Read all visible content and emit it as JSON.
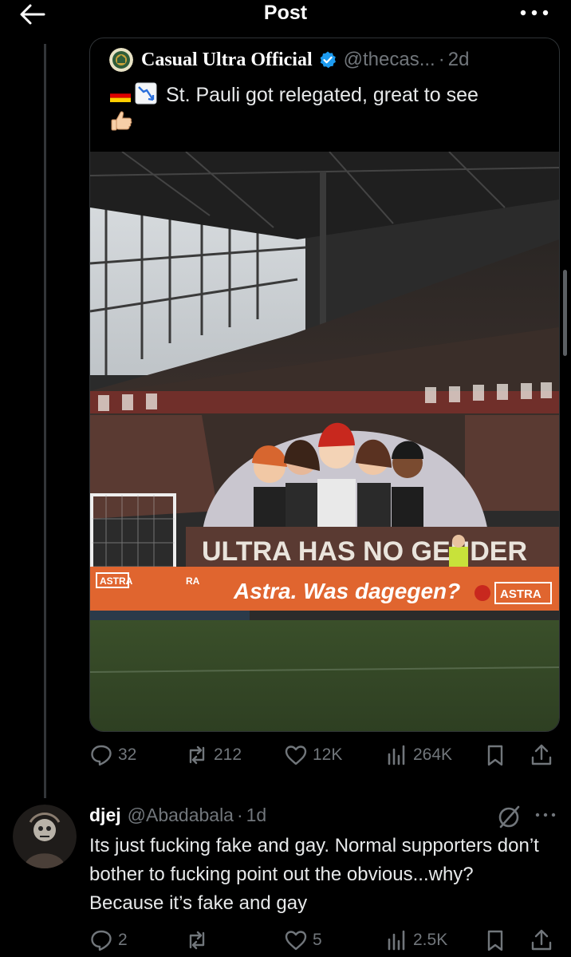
{
  "header": {
    "title": "Post",
    "back_icon": "arrow-left-icon",
    "more_icon": "more-horizontal-icon"
  },
  "quote": {
    "author_name": "Casual Ultra Official",
    "author_handle": "@thecas...",
    "separator": "·",
    "time": "2d",
    "verified": true,
    "text": "St. Pauli got relegated, great to see",
    "emojis": [
      "germany-flag-emoji",
      "chart-decreasing-emoji",
      "thumbs-up-emoji"
    ],
    "media": {
      "banner_text": "ULTRA HAS NO GENDER",
      "ad_text": "Astra. Was dagegen?",
      "sponsor": "ASTRA",
      "left_sponsor": "ASTRA",
      "mid_sponsor": "RA"
    }
  },
  "post_stats": {
    "replies": "32",
    "reposts": "212",
    "likes": "12K",
    "views": "264K"
  },
  "reply": {
    "name": "djej",
    "handle": "@Abadabala",
    "separator": "·",
    "time": "1d",
    "text": "Its just fucking fake and gay. Normal supporters don’t bother to fucking point out the obvious...why? Because it’s fake  and gay",
    "stats": {
      "replies": "2",
      "reposts": "",
      "likes": "5",
      "views": "2.5K"
    }
  },
  "colors": {
    "background": "#000000",
    "text": "#e7e9ea",
    "muted": "#71767b",
    "verified": "#1d9bf0",
    "border": "#2f3336"
  }
}
